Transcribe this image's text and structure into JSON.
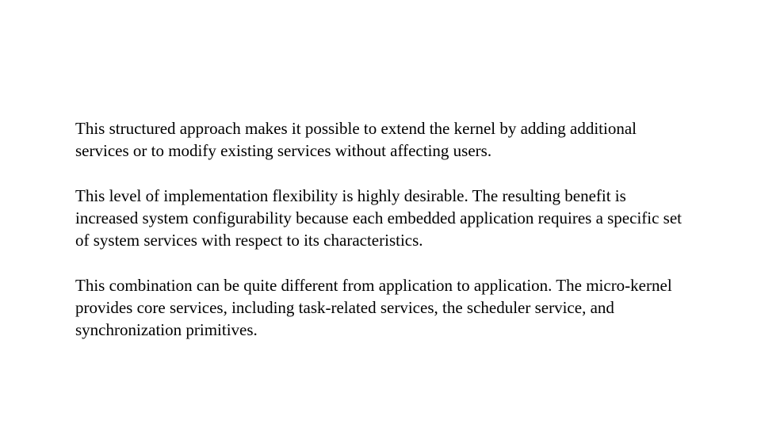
{
  "paragraphs": [
    "This structured approach makes it possible to extend the kernel by adding additional services or to modify existing services without affecting users.",
    "This level of implementation flexibility is highly desirable. The resulting benefit is increased system configurability because each embedded application requires a specific set of system services with respect to its characteristics.",
    "This combination can be quite different from application to application. The micro-kernel provides core services, including task-related services, the scheduler service, and synchronization primitives."
  ]
}
